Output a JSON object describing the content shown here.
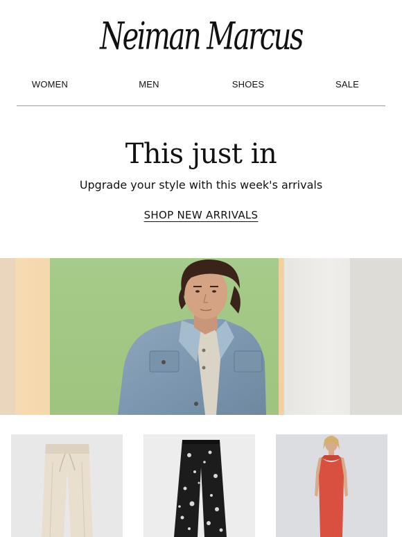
{
  "brand": {
    "logo_text": "Neiman Marcus"
  },
  "nav": {
    "items": [
      {
        "label": "WOMEN"
      },
      {
        "label": "MEN"
      },
      {
        "label": "SHOES"
      },
      {
        "label": "SALE"
      }
    ]
  },
  "hero": {
    "headline_plain": "This",
    "headline_italic": "just in",
    "subhead": "Upgrade your style with this week's arrivals",
    "cta_label": "SHOP NEW ARRIVALS"
  },
  "colors": {
    "text": "#111111",
    "divider": "#9a9a9a",
    "background": "#ffffff"
  },
  "products": [
    {
      "icon": "cream-drawstring-pants-image"
    },
    {
      "icon": "black-lace-pants-image"
    },
    {
      "icon": "red-sheath-dress-image"
    }
  ]
}
